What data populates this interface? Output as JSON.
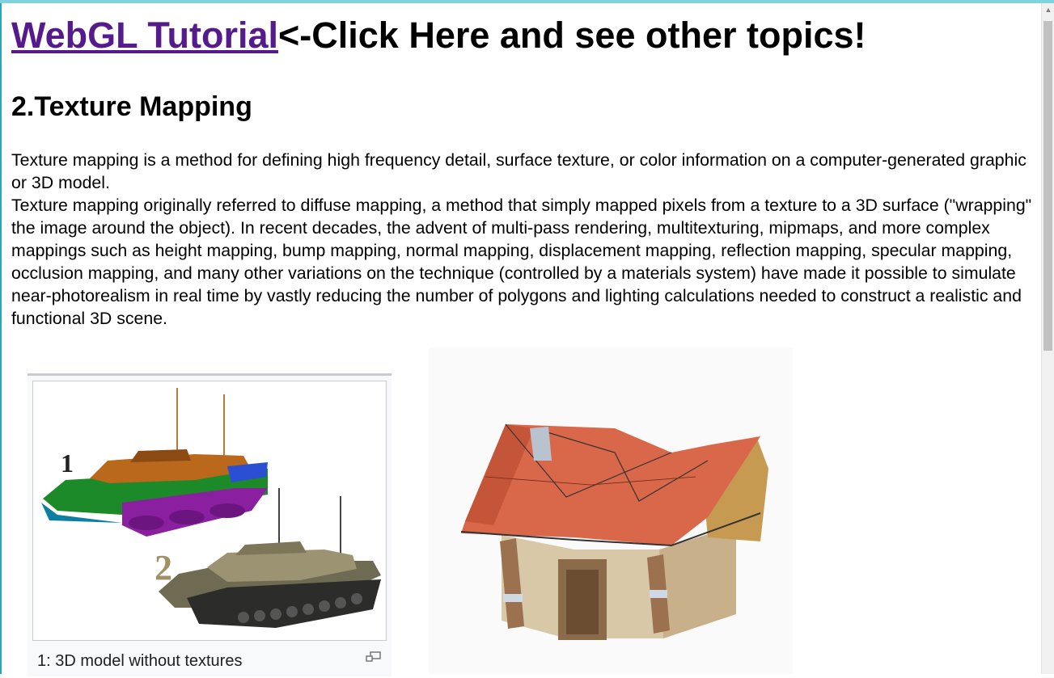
{
  "header": {
    "link_text": "WebGL Tutorial",
    "suffix_text": "<-Click Here and see other topics!"
  },
  "section": {
    "title": "2.Texture Mapping"
  },
  "paragraphs": [
    "Texture mapping is a method for defining high frequency detail, surface texture, or color information on a computer-generated graphic or 3D model.",
    "Texture mapping originally referred to diffuse mapping, a method that simply mapped pixels from a texture to a 3D surface (\"wrapping\" the image around the object). In recent decades, the advent of multi-pass rendering, multitexturing, mipmaps, and more complex mappings such as height mapping, bump mapping, normal mapping, displacement mapping, reflection mapping, specular mapping, occlusion mapping, and many other variations on the technique (controlled by a materials system) have made it possible to simulate near-photorealism in real time by vastly reducing the number of polygons and lighting calculations needed to construct a realistic and functional 3D scene."
  ],
  "figures": {
    "tank": {
      "label_1": "1",
      "label_2": "2",
      "caption": "1: 3D model without textures"
    }
  },
  "icons": {
    "enlarge": "magnify-icon",
    "scroll_up": "scroll-up-arrow-icon"
  },
  "colors": {
    "link": "#551a8b",
    "accent_top": "#7fd3dc"
  }
}
